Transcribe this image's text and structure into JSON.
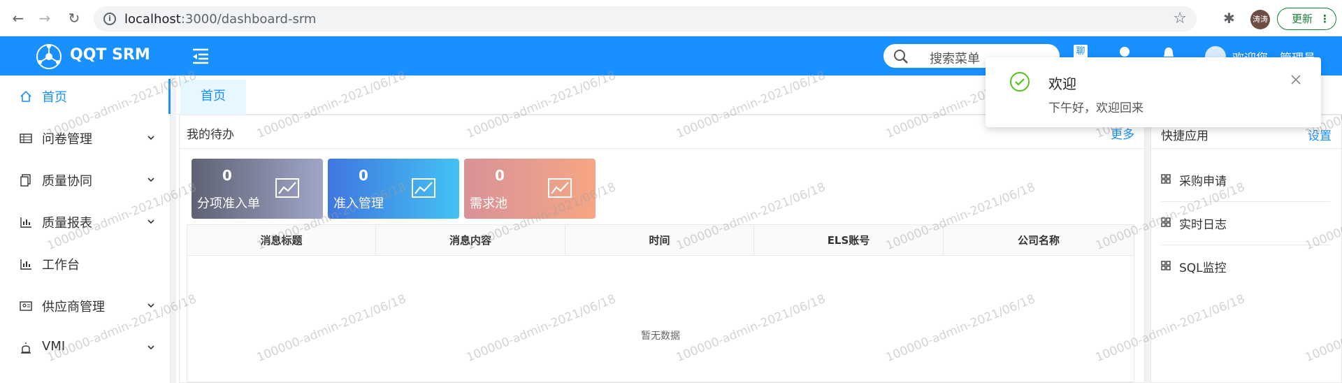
{
  "browser": {
    "url_host": "localhost",
    "url_path": ":3000/dashboard-srm",
    "profile_initials": "涛涛",
    "update_label": "更新",
    "update_menu": "⋮"
  },
  "header": {
    "brand": "QQT SRM",
    "search_placeholder": "搜索菜单",
    "chat_label": "聊",
    "welcome_text": "欢迎您，管理员"
  },
  "sidebar": {
    "items": [
      {
        "label": "首页"
      },
      {
        "label": "问卷管理"
      },
      {
        "label": "质量协同"
      },
      {
        "label": "质量报表"
      },
      {
        "label": "工作台"
      },
      {
        "label": "供应商管理"
      },
      {
        "label": "VMI"
      }
    ]
  },
  "tabs": [
    {
      "label": "首页"
    }
  ],
  "todo": {
    "title": "我的待办",
    "more": "更多",
    "cards": [
      {
        "count": "0",
        "label": "分项准入单"
      },
      {
        "count": "0",
        "label": "准入管理"
      },
      {
        "count": "0",
        "label": "需求池"
      }
    ],
    "table": {
      "columns": [
        "消息标题",
        "消息内容",
        "时间",
        "ELS账号",
        "公司名称"
      ],
      "empty_text": "暂无数据"
    }
  },
  "quick": {
    "title": "快捷应用",
    "settings": "设置",
    "items": [
      {
        "label": "采购申请"
      },
      {
        "label": "实时日志"
      },
      {
        "label": "SQL监控"
      }
    ]
  },
  "notification": {
    "title": "欢迎",
    "description": "下午好，欢迎回来"
  },
  "watermark": "100000-admin-2021/06/18",
  "colors": {
    "primary": "#1890ff",
    "success": "#52c41a",
    "card1": "#6b6f86",
    "card2": "#3b9cf0",
    "card3": "#e8a08c"
  }
}
